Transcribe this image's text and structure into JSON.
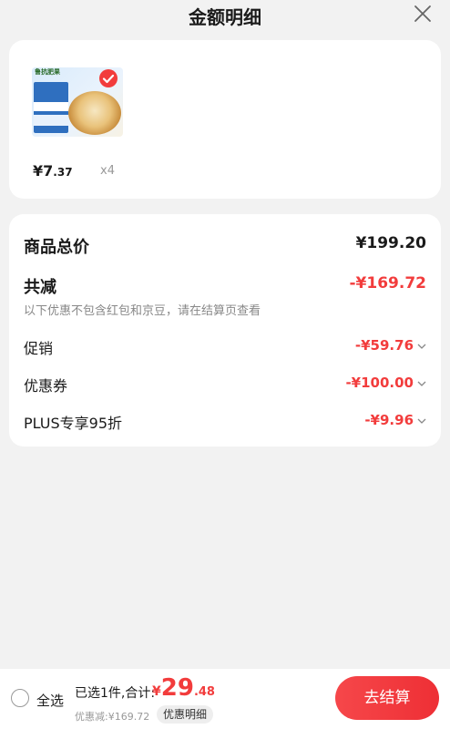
{
  "header": {
    "title": "金额明细"
  },
  "product": {
    "thumb_brand": "鲁抗肥果",
    "price_currency": "¥",
    "price_integer": "7",
    "price_decimal": ".37",
    "quantity": "x4",
    "selected": true
  },
  "summary": {
    "total_label": "商品总价",
    "total_value": "¥199.20",
    "reduce_label": "共减",
    "reduce_value": "-¥169.72",
    "note": "以下优惠不包含红包和京豆，请在结算页查看",
    "items": [
      {
        "label": "促销",
        "value": "-¥59.76"
      },
      {
        "label": "优惠券",
        "value": "-¥100.00"
      },
      {
        "label": "PLUS专享95折",
        "value": "-¥9.96"
      }
    ]
  },
  "bottom_bar": {
    "select_all": "全选",
    "selected_prefix": "已选1件,合计:",
    "total_currency": "¥",
    "total_integer": "29",
    "total_decimal": ".48",
    "discount_text": "优惠减:¥169.72",
    "detail_button": "优惠明细",
    "checkout_button": "去结算"
  },
  "colors": {
    "accent": "#f23c3c",
    "background": "#f2f2f2",
    "card": "#ffffff"
  }
}
